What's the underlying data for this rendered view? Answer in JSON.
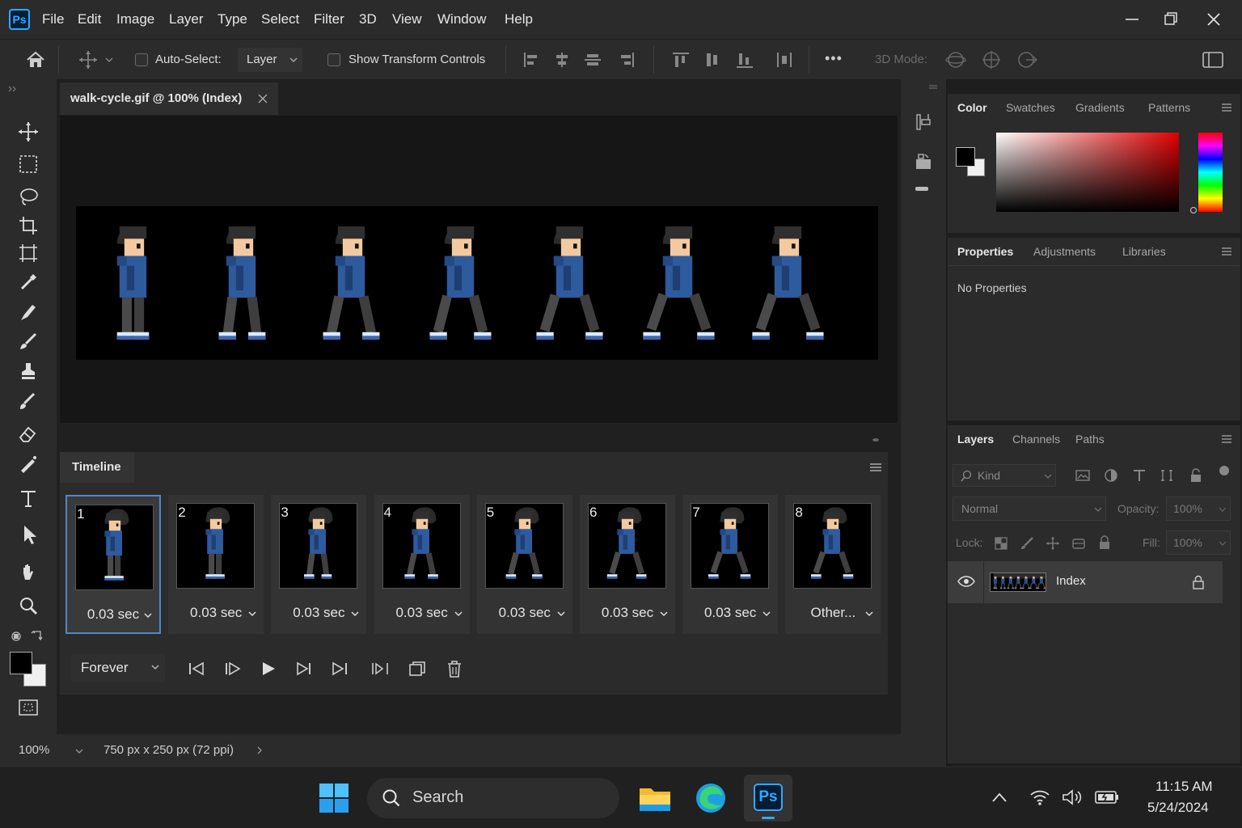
{
  "app": {
    "name": "Ps"
  },
  "menu": [
    "File",
    "Edit",
    "Image",
    "Layer",
    "Type",
    "Select",
    "Filter",
    "3D",
    "View",
    "Window",
    "Help"
  ],
  "options": {
    "auto_select_label": "Auto-Select:",
    "auto_select_value": "Layer",
    "show_transform_label": "Show Transform Controls",
    "mode_3d_label": "3D Mode:",
    "more": "•••"
  },
  "document": {
    "tab_title": "walk-cycle.gif @ 100% (Index)"
  },
  "timeline": {
    "title": "Timeline",
    "frames": [
      {
        "num": "1",
        "delay": "0.03 sec"
      },
      {
        "num": "2",
        "delay": "0.03 sec"
      },
      {
        "num": "3",
        "delay": "0.03 sec"
      },
      {
        "num": "4",
        "delay": "0.03 sec"
      },
      {
        "num": "5",
        "delay": "0.03 sec"
      },
      {
        "num": "6",
        "delay": "0.03 sec"
      },
      {
        "num": "7",
        "delay": "0.03 sec"
      },
      {
        "num": "8",
        "delay": "Other..."
      }
    ],
    "loop": "Forever"
  },
  "status": {
    "zoom": "100%",
    "doc_info": "750 px x 250 px (72 ppi)"
  },
  "color_panel": {
    "tabs": [
      "Color",
      "Swatches",
      "Gradients",
      "Patterns"
    ]
  },
  "properties_panel": {
    "tabs": [
      "Properties",
      "Adjustments",
      "Libraries"
    ],
    "message": "No Properties"
  },
  "layers_panel": {
    "tabs": [
      "Layers",
      "Channels",
      "Paths"
    ],
    "filter_kind": "Kind",
    "blend_mode": "Normal",
    "opacity_label": "Opacity:",
    "opacity_value": "100%",
    "lock_label": "Lock:",
    "fill_label": "Fill:",
    "fill_value": "100%",
    "layers": [
      {
        "name": "Index"
      }
    ]
  },
  "taskbar": {
    "search": "Search",
    "time": "11:15 AM",
    "date": "5/24/2024"
  },
  "colors": {
    "accent": "#31a8ff",
    "selection": "#4e88c8",
    "hoodie": "#2e5a9e"
  }
}
